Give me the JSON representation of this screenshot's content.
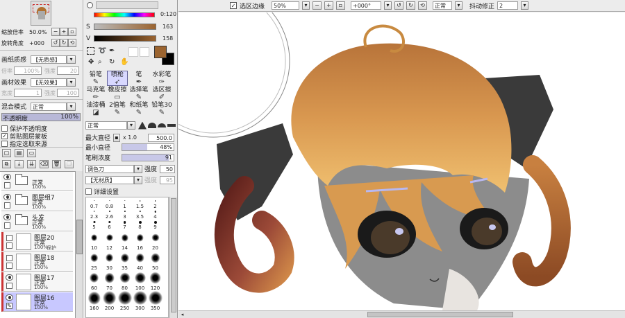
{
  "navigator": {
    "zoom_label": "缩放倍率",
    "zoom_value": "50.0%",
    "rotate_label": "旋转角度",
    "rotate_value": "+000"
  },
  "paper": {
    "texture_label": "画纸质感",
    "texture_value": "【无质感】",
    "scale_label": "倍率",
    "scale_value": "100%",
    "strength_label": "强度",
    "strength_value": "20",
    "effect_label": "画材效果",
    "effect_value": "【无效果】",
    "width_label": "宽度",
    "width_value": "1",
    "effect_strength_label": "强度",
    "effect_strength_value": "100"
  },
  "layer_props": {
    "blend_label": "混合模式",
    "blend_value": "正常",
    "opacity_label": "不透明度",
    "opacity_value": "100%",
    "protect_label": "保护不透明度",
    "clip_label": "剪贴图层蒙板",
    "select_source_label": "指定选取来源"
  },
  "layers": [
    {
      "name": "",
      "mode": "正常",
      "opacity": "100%",
      "type": "folder"
    },
    {
      "name": "图层组7",
      "mode": "正常",
      "opacity": "100%",
      "type": "folder"
    },
    {
      "name": "头发",
      "mode": "正常",
      "opacity": "100%",
      "type": "folder"
    },
    {
      "name": "图层20",
      "mode": "正常",
      "opacity": "100%",
      "type": "layer",
      "note": "保护"
    },
    {
      "name": "图层18",
      "mode": "正常",
      "opacity": "100%",
      "type": "layer"
    },
    {
      "name": "图层17",
      "mode": "正常",
      "opacity": "100%",
      "type": "layer"
    },
    {
      "name": "图层16",
      "mode": "正常",
      "opacity": "100%",
      "type": "layer"
    }
  ],
  "color": {
    "h_value": "0:120",
    "s_label": "S",
    "s_value": "163",
    "v_label": "V",
    "v_value": "158",
    "fg_color": "#9b6430",
    "bg_color": "#000000"
  },
  "tools": [
    {
      "label": "铅笔",
      "icon": "pencil-icon",
      "glyph": "✎"
    },
    {
      "label": "喷枪",
      "icon": "airbrush-icon",
      "glyph": "➶"
    },
    {
      "label": "笔",
      "icon": "pen-icon",
      "glyph": "✒"
    },
    {
      "label": "水彩笔",
      "icon": "watercolor-icon",
      "glyph": "✑"
    },
    {
      "label": "马克笔",
      "icon": "marker-icon",
      "glyph": "✏"
    },
    {
      "label": "橡皮擦",
      "icon": "eraser-icon",
      "glyph": "▭"
    },
    {
      "label": "选择笔",
      "icon": "select-pen-icon",
      "glyph": "✎"
    },
    {
      "label": "选区擦",
      "icon": "select-eraser-icon",
      "glyph": "✐"
    },
    {
      "label": "油漆桶",
      "icon": "bucket-icon",
      "glyph": "◪"
    },
    {
      "label": "2值笔",
      "icon": "binary-pen-icon",
      "glyph": "✎"
    },
    {
      "label": "和纸笔",
      "icon": "washi-pen-icon",
      "glyph": "✎"
    },
    {
      "label": "铅笔30",
      "icon": "pencil30-icon",
      "glyph": "✎"
    }
  ],
  "brush": {
    "mode_value": "正常",
    "max_size_label": "最大直径",
    "max_size_mult": "x 1.0",
    "max_size_value": "500.0",
    "min_size_label": "最小直径",
    "min_size_value": "48%",
    "density_label": "笔刷浓度",
    "density_value": "91",
    "blend_value": "调色刀",
    "blend_strength_label": "强度",
    "blend_strength_value": "50",
    "texture_value": "【无材质】",
    "texture_strength_label": "强度",
    "texture_strength_value": "95",
    "detail_label": "详细设置"
  },
  "brush_sizes": {
    "small": [
      "0.7",
      "0.8",
      "1",
      "1.5",
      "2",
      "2.3",
      "2.6",
      "3",
      "3.5",
      "4",
      "5",
      "6",
      "7",
      "8",
      "9"
    ],
    "large": [
      "10",
      "12",
      "14",
      "16",
      "20",
      "25",
      "30",
      "35",
      "40",
      "50",
      "60",
      "70",
      "80",
      "100",
      "120",
      "160",
      "200",
      "250",
      "300",
      "350"
    ]
  },
  "toolbar": {
    "selection_edge_label": "选区边缘",
    "zoom_value": "50%",
    "rotate_value": "+000°",
    "mode_value": "正常",
    "stabilizer_label": "抖动修正",
    "stabilizer_value": "2"
  }
}
